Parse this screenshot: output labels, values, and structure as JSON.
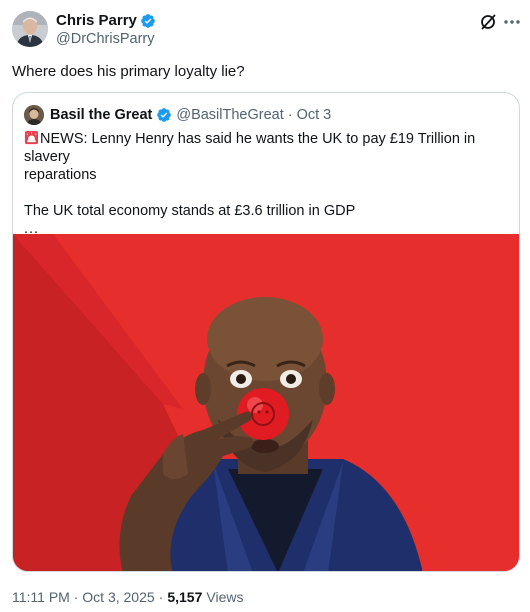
{
  "tweet": {
    "author": {
      "name": "Chris Parry",
      "handle": "@DrChrisParry",
      "verified": true
    },
    "text": "Where does his primary loyalty lie?",
    "timestamp": "11:11 PM · Oct 3, 2025",
    "separator": "·",
    "views_count": "5,157",
    "views_label": "Views"
  },
  "quote": {
    "author": {
      "name": "Basil the Great",
      "handle": "@BasilTheGreat",
      "verified": true
    },
    "separator": "·",
    "date": "Oct 3",
    "line1": "NEWS: Lenny Henry has said he wants the UK to pay £19 Trillion in slavery",
    "line2": "reparations",
    "line3": "The UK total economy stands at £3.6 trillion in GDP",
    "ellipsis": "...",
    "leading_icon": "siren-emoji",
    "image_icon": "man-with-red-nose-photo"
  },
  "colors": {
    "verified": "#1d9bf0",
    "text": "#0f1419",
    "muted": "#536471",
    "border": "#cfd9de",
    "photo_red": "#e0282a"
  },
  "icons": {
    "verified": "verified-badge-icon",
    "grok": "grok-icon",
    "more": "more-options-icon"
  }
}
